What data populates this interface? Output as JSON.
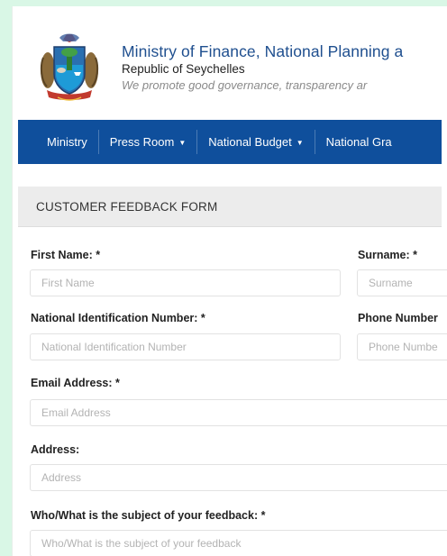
{
  "header": {
    "title": "Ministry of Finance, National Planning a",
    "subtitle": "Republic of Seychelles",
    "tagline": "We promote good governance, transparency ar"
  },
  "nav": {
    "items": [
      {
        "label": "Ministry",
        "caret": false
      },
      {
        "label": "Press Room",
        "caret": true
      },
      {
        "label": "National Budget",
        "caret": true
      },
      {
        "label": "National Gra",
        "caret": false
      }
    ]
  },
  "form": {
    "title": "CUSTOMER FEEDBACK FORM",
    "first_name": {
      "label": "First Name: *",
      "placeholder": "First Name"
    },
    "surname": {
      "label": "Surname: *",
      "placeholder": "Surname"
    },
    "nin": {
      "label": "National Identification Number: *",
      "placeholder": "National Identification Number"
    },
    "phone": {
      "label": "Phone Number",
      "placeholder": "Phone Numbe"
    },
    "email": {
      "label": "Email Address: *",
      "placeholder": "Email Address"
    },
    "address": {
      "label": "Address:",
      "placeholder": "Address"
    },
    "subject": {
      "label": "Who/What is the subject of your feedback: *",
      "placeholder": "Who/What is the subject of your feedback"
    }
  },
  "colors": {
    "title": "#1f4f8f",
    "nav_bg": "#0f4f9c",
    "panel_bg": "#ececec",
    "page_bg": "#d9f7e6"
  }
}
